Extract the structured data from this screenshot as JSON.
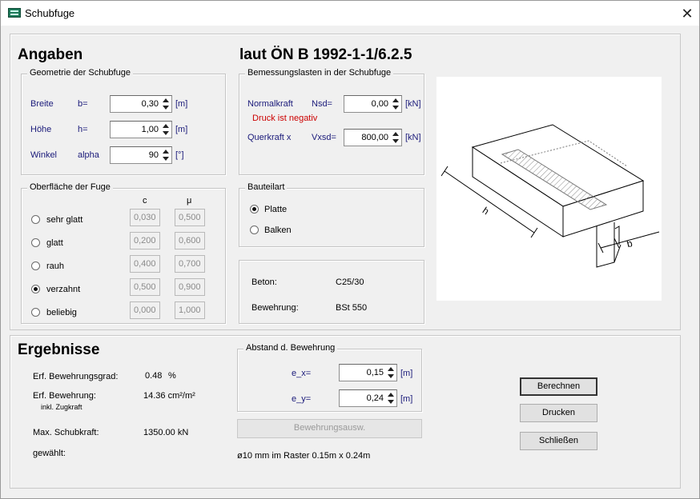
{
  "window": {
    "title": "Schubfuge",
    "app_icon": "app-icon",
    "close_glyph": "✕"
  },
  "angaben": {
    "heading": "Angaben",
    "norm_heading": "laut ÖN B 1992-1-1/6.2.5",
    "geometrie": {
      "title": "Geometrie der Schubfuge",
      "rows": [
        {
          "label": "Breite",
          "sym": "b=",
          "value": "0,30",
          "unit": "[m]"
        },
        {
          "label": "Höhe",
          "sym": "h=",
          "value": "1,00",
          "unit": "[m]"
        },
        {
          "label": "Winkel",
          "sym": "alpha",
          "value": "90",
          "unit": "[°]"
        }
      ]
    },
    "lasten": {
      "title": "Bemessungslasten in der Schubfuge",
      "normalkraft": {
        "label": "Normalkraft",
        "sym": "Nsd=",
        "value": "0,00",
        "unit": "[kN]",
        "hint": "Druck ist negativ"
      },
      "querkraft": {
        "label": "Querkraft x",
        "sym": "Vxsd=",
        "value": "800,00",
        "unit": "[kN]"
      }
    },
    "oberflaeche": {
      "title": "Oberfläche der Fuge",
      "col_c": "c",
      "col_mu": "μ",
      "rows": [
        {
          "label": "sehr glatt",
          "c": "0,030",
          "mu": "0,500",
          "selected": false
        },
        {
          "label": "glatt",
          "c": "0,200",
          "mu": "0,600",
          "selected": false
        },
        {
          "label": "rauh",
          "c": "0,400",
          "mu": "0,700",
          "selected": false
        },
        {
          "label": "verzahnt",
          "c": "0,500",
          "mu": "0,900",
          "selected": true
        },
        {
          "label": "beliebig",
          "c": "0,000",
          "mu": "1,000",
          "selected": false
        }
      ]
    },
    "bauteilart": {
      "title": "Bauteilart",
      "options": [
        {
          "label": "Platte",
          "selected": true
        },
        {
          "label": "Balken",
          "selected": false
        }
      ]
    },
    "material": {
      "beton_label": "Beton:",
      "beton_value": "C25/30",
      "bewehrung_label": "Bewehrung:",
      "bewehrung_value": "BSt 550"
    },
    "diagram": {
      "label_h": "h",
      "label_b": "b"
    }
  },
  "ergebnisse": {
    "heading": "Ergebnisse",
    "grad_label": "Erf. Bewehrungsgrad:",
    "grad_value": "0.48",
    "grad_unit": "%",
    "bew_label": "Erf. Bewehrung:",
    "bew_value": "14.36 cm²/m²",
    "bew_note": "inkl. Zugkraft",
    "schub_label": "Max. Schubkraft:",
    "schub_value": "1350.00 kN",
    "gewaehlt_label": "gewählt:",
    "abstand": {
      "title": "Abstand d. Bewehrung",
      "ex": {
        "label": "e_x=",
        "value": "0,15",
        "unit": "[m]"
      },
      "ey": {
        "label": "e_y=",
        "value": "0,24",
        "unit": "[m]"
      }
    },
    "auswahl_button": "Bewehrungsausw.",
    "raster_text": "ø10 mm im Raster 0.15m x 0.24m"
  },
  "buttons": {
    "berechnen": "Berechnen",
    "drucken": "Drucken",
    "schliessen": "Schließen"
  }
}
